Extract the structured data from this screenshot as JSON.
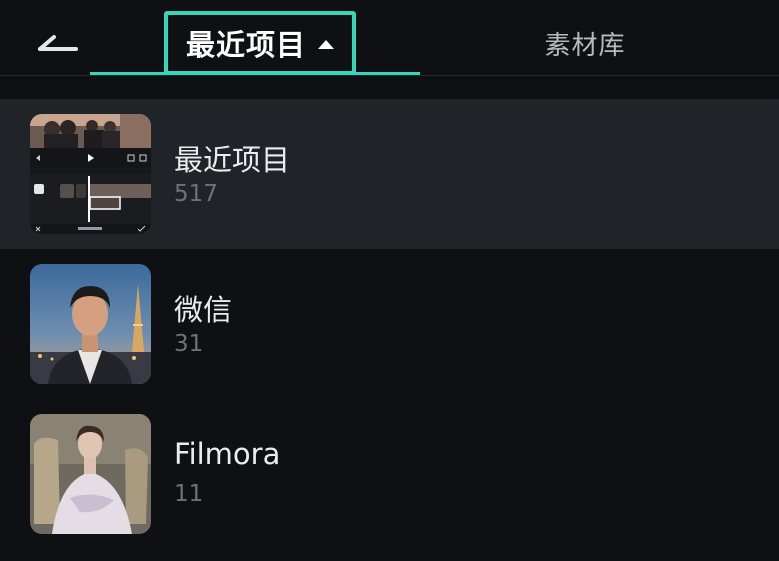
{
  "header": {
    "back_icon": "back-arrow-icon",
    "active_tab": {
      "label": "最近项目",
      "indicator_icon": "caret-up-icon"
    },
    "library_tab": {
      "label": "素材库"
    },
    "accent_color": "#36d7b7"
  },
  "albums": [
    {
      "name": "最近项目",
      "count": "517",
      "selected": true,
      "thumbnail": "editor-screenshot"
    },
    {
      "name": "微信",
      "count": "31",
      "selected": false,
      "thumbnail": "portrait-man-eiffel-tower"
    },
    {
      "name": "Filmora",
      "count": "11",
      "selected": false,
      "thumbnail": "painting-woman-white-dress"
    }
  ]
}
